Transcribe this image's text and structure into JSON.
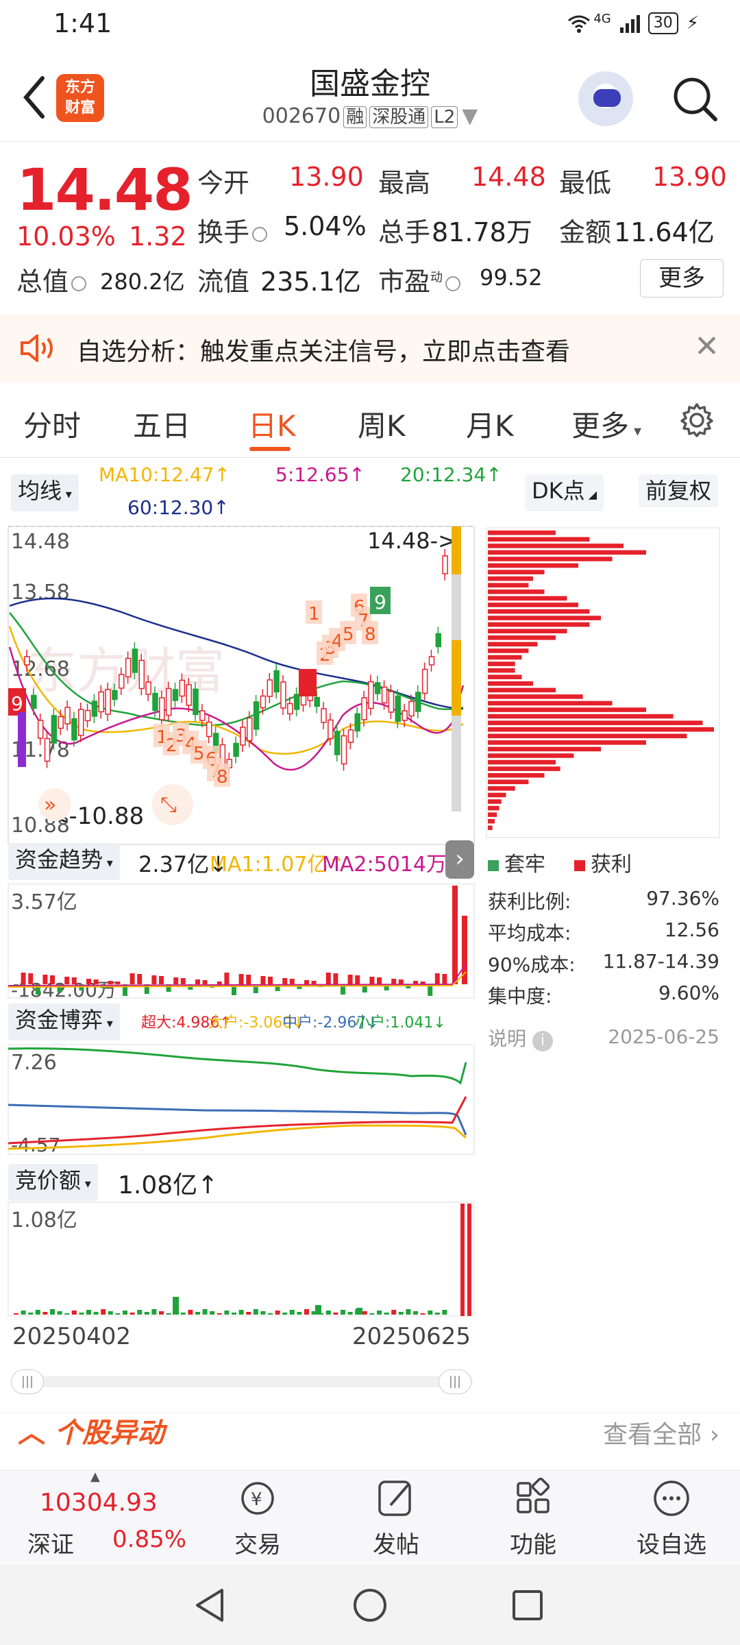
{
  "status": {
    "time": "1:41",
    "network": "4G",
    "battery": "30"
  },
  "header": {
    "stock_name": "国盛金控",
    "code": "002670",
    "tags": [
      "融",
      "深股通",
      "L2"
    ],
    "logo_text": "东方财富"
  },
  "quote": {
    "price": "14.48",
    "pct": "10.03%",
    "change": "1.32",
    "open_label": "今开",
    "open": "13.90",
    "high_label": "最高",
    "high": "14.48",
    "low_label": "最低",
    "low": "13.90",
    "turnover_label": "换手",
    "turnover": "5.04%",
    "volume_label": "总手",
    "volume": "81.78万",
    "amount_label": "金额",
    "amount": "11.64亿",
    "mcap_label": "总值",
    "mcap": "280.2亿",
    "float_label": "流值",
    "float": "235.1亿",
    "pe_label": "市盈",
    "pe_sup": "动",
    "pe": "99.52",
    "more": "更多"
  },
  "banner": {
    "text": "自选分析：触发重点关注信号，立即点击查看"
  },
  "tabs": [
    "分时",
    "五日",
    "日K",
    "周K",
    "月K",
    "更多"
  ],
  "active_tab": "日K",
  "kline": {
    "ma_selector": "均线",
    "ma10": "MA10:12.47↑",
    "ma5": "5:12.65↑",
    "ma20": "20:12.34↑",
    "ma60": "60:12.30↑",
    "dk_button": "DK点",
    "adjust_button": "前复权",
    "axis": [
      "14.48",
      "13.58",
      "12.68",
      "11.78",
      "10.88"
    ],
    "max_flag": "14.48->",
    "min_flag": "<-10.88",
    "signals_top": [
      "1",
      "2",
      "3",
      "4",
      "5",
      "6",
      "7",
      "8"
    ],
    "signal_nine": "9"
  },
  "chip": {
    "legend_trapped": "套牢",
    "legend_profit": "获利",
    "rows": [
      {
        "label": "获利比例:",
        "value": "97.36%"
      },
      {
        "label": "平均成本:",
        "value": "12.56"
      },
      {
        "label": "90%成本:",
        "value": "11.87-14.39"
      },
      {
        "label": "集中度:",
        "value": "9.60%"
      }
    ],
    "note": "说明",
    "date": "2025-06-25"
  },
  "fund_trend": {
    "selector": "资金趋势",
    "value": "2.37亿↓",
    "ma1": "MA1:1.07亿↑",
    "ma2": "MA2:5014万↑",
    "top": "3.57亿",
    "bottom": "-1842.00万"
  },
  "fund_game": {
    "selector": "资金博弈",
    "super": "超大:4.986↑",
    "big": "大户:-3.060↓",
    "mid": "中户:-2.967↓",
    "small": "小户:1.041↓",
    "top": "7.26",
    "bottom": "-4.57"
  },
  "auction": {
    "selector": "竞价额",
    "value": "1.08亿↑",
    "top": "1.08亿"
  },
  "dates": {
    "start": "20250402",
    "end": "20250625"
  },
  "section": {
    "title": "个股异动",
    "view_all": "查看全部"
  },
  "index": {
    "value": "10304.93",
    "name": "深证",
    "pct": "0.85%"
  },
  "bottom_nav": [
    "交易",
    "发帖",
    "功能",
    "设自选"
  ],
  "colors": {
    "up": "#e5212b",
    "down": "#1fa33a",
    "accent": "#f0541e",
    "ma10": "#f2b600",
    "ma5": "#c9188f",
    "ma20": "#1fa33a",
    "ma60": "#1b2e8c"
  }
}
